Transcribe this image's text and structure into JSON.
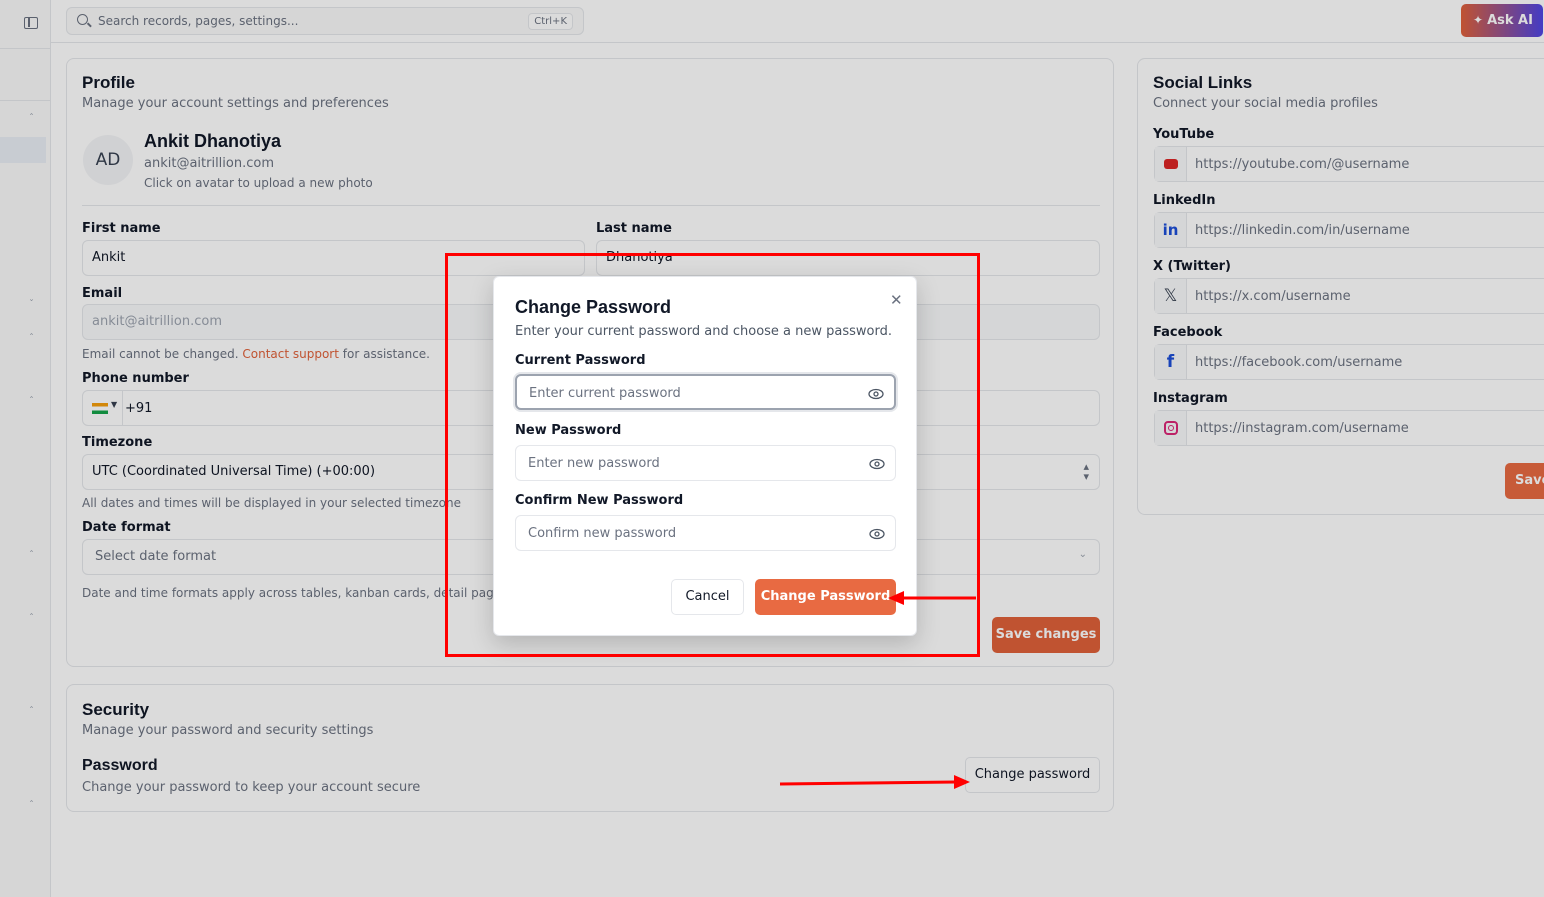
{
  "topbar": {
    "search_placeholder": "Search records, pages, settings...",
    "search_shortcut": "Ctrl+K",
    "ask_ai_label": "Ask AI"
  },
  "profile": {
    "title": "Profile",
    "subtitle": "Manage your account settings and preferences",
    "avatar_initials": "AD",
    "name": "Ankit Dhanotiya",
    "email": "ankit@aitrillion.com",
    "avatar_hint": "Click on avatar to upload a new photo",
    "first_name_label": "First name",
    "first_name_value": "Ankit",
    "last_name_label": "Last name",
    "last_name_value": "Dhanotiya",
    "email_label": "Email",
    "email_value": "ankit@aitrillion.com",
    "email_help_pre": "Email cannot be changed.",
    "email_help_link": "Contact support",
    "email_help_post": "for assistance.",
    "phone_label": "Phone number",
    "phone_code": "+91",
    "timezone_label": "Timezone",
    "timezone_value": "UTC (Coordinated Universal Time) (+00:00)",
    "timezone_help": "All dates and times will be displayed in your selected timezone",
    "date_format_label": "Date format",
    "date_format_placeholder": "Select date format",
    "date_format_help": "Date and time formats apply across tables, kanban cards, detail pages",
    "save_label": "Save changes"
  },
  "security": {
    "title": "Security",
    "subtitle": "Manage your password and security settings",
    "password_title": "Password",
    "password_subtitle": "Change your password to keep your account secure",
    "change_password_button": "Change password"
  },
  "social": {
    "title": "Social Links",
    "subtitle": "Connect your social media profiles",
    "items": [
      {
        "label": "YouTube",
        "placeholder": "https://youtube.com/@username",
        "icon": "youtube-icon",
        "color": "#dc2626"
      },
      {
        "label": "LinkedIn",
        "placeholder": "https://linkedin.com/in/username",
        "icon": "linkedin-icon",
        "color": "#1d4ed8"
      },
      {
        "label": "X (Twitter)",
        "placeholder": "https://x.com/username",
        "icon": "x-icon",
        "color": "#111827"
      },
      {
        "label": "Facebook",
        "placeholder": "https://facebook.com/username",
        "icon": "facebook-icon",
        "color": "#1d4ed8"
      },
      {
        "label": "Instagram",
        "placeholder": "https://instagram.com/username",
        "icon": "instagram-icon",
        "color": "#db2777"
      }
    ],
    "save_label": "Save"
  },
  "modal": {
    "title": "Change Password",
    "subtitle": "Enter your current password and choose a new password.",
    "current_label": "Current Password",
    "current_placeholder": "Enter current password",
    "new_label": "New Password",
    "new_placeholder": "Enter new password",
    "confirm_label": "Confirm New Password",
    "confirm_placeholder": "Confirm new password",
    "cancel_label": "Cancel",
    "submit_label": "Change Password"
  },
  "colors": {
    "accent": "#e86a42",
    "annotation": "#ff0000",
    "link": "#e0613a"
  }
}
